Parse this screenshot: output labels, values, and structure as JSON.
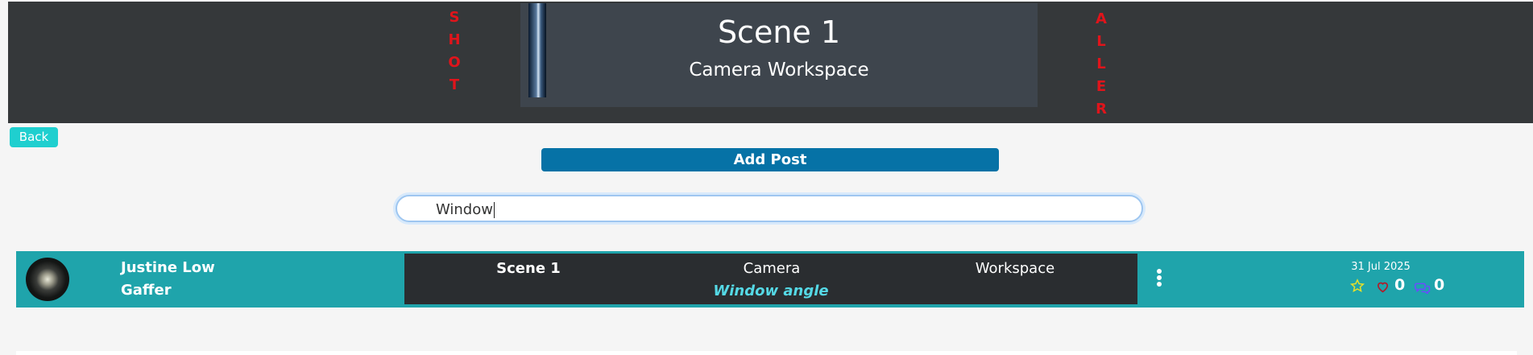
{
  "header": {
    "left_vertical": [
      "S",
      "H",
      "O",
      "T"
    ],
    "right_vertical": [
      "A",
      "L",
      "L",
      "E",
      "R"
    ],
    "scene_title": "Scene 1",
    "scene_subtitle": "Camera Workspace"
  },
  "actions": {
    "back_label": "Back",
    "add_post_label": "Add Post"
  },
  "search": {
    "value": "Window"
  },
  "posts": [
    {
      "author": "Justine Low",
      "role": "Gaffer",
      "scene": "Scene 1",
      "department": "Camera",
      "area": "Workspace",
      "caption": "Window angle",
      "date": "31 Jul 2025",
      "likes": "0",
      "comments": "0"
    }
  ],
  "colors": {
    "banner": "#35383a",
    "vertical_text": "#e0141b",
    "scene_card": "#3e454d",
    "back_button": "#1fcfcf",
    "add_post_button": "#0672a6",
    "post_row": "#1fa4ab",
    "post_card": "#2a2d30",
    "caption": "#55d9e6",
    "star_icon": "#e6e02a",
    "heart_icon": "#b01c2a",
    "comment_icon": "#6a4cff"
  }
}
